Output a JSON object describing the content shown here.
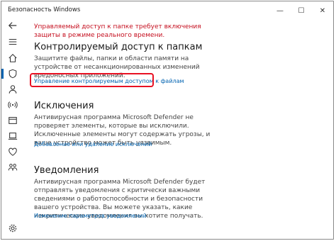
{
  "window": {
    "title": "Безопасность Windows",
    "minimize": "—",
    "maximize": "☐",
    "close": "✕"
  },
  "sidebar": {
    "items": [
      {
        "icon": "back-arrow-icon"
      },
      {
        "icon": "menu-icon"
      },
      {
        "icon": "home-icon"
      },
      {
        "icon": "shield-icon",
        "active": true
      },
      {
        "icon": "person-icon"
      },
      {
        "icon": "wifi-icon"
      },
      {
        "icon": "app-window-icon"
      },
      {
        "icon": "laptop-icon"
      },
      {
        "icon": "heart-icon"
      },
      {
        "icon": "family-icon"
      },
      {
        "icon": "gear-icon"
      }
    ]
  },
  "warning": "Управляемый доступ к папке требует включения защиты в режиме реального времени.",
  "sections": {
    "controlled": {
      "title": "Контролируемый доступ к папкам",
      "body": "Защитите файлы, папки и области памяти на устройстве от несанкционированных изменений вредоносных приложений.",
      "link": "Управление контролируемым доступом к файлам"
    },
    "exclusions": {
      "title": "Исключения",
      "body": "Антивирусная программа Microsoft Defender не проверяет элементы, которые вы исключили. Исключенные элементы могут содержать угрозы, и ваше устройство может быть уязвимым.",
      "link": "Добавление или удаление исключений"
    },
    "notifications": {
      "title": "Уведомления",
      "body": "Антивирусная программа Microsoft Defender будет отправлять уведомления с критически важными сведениями о работоспособности и безопасности вашего устройства. Вы можете указать, какие некритические уведомления вы хотите получать.",
      "link": "Изменение параметров уведомлений"
    }
  },
  "colors": {
    "accent": "#0063b1",
    "warning": "#c50f1f",
    "highlight": "#e81123"
  }
}
